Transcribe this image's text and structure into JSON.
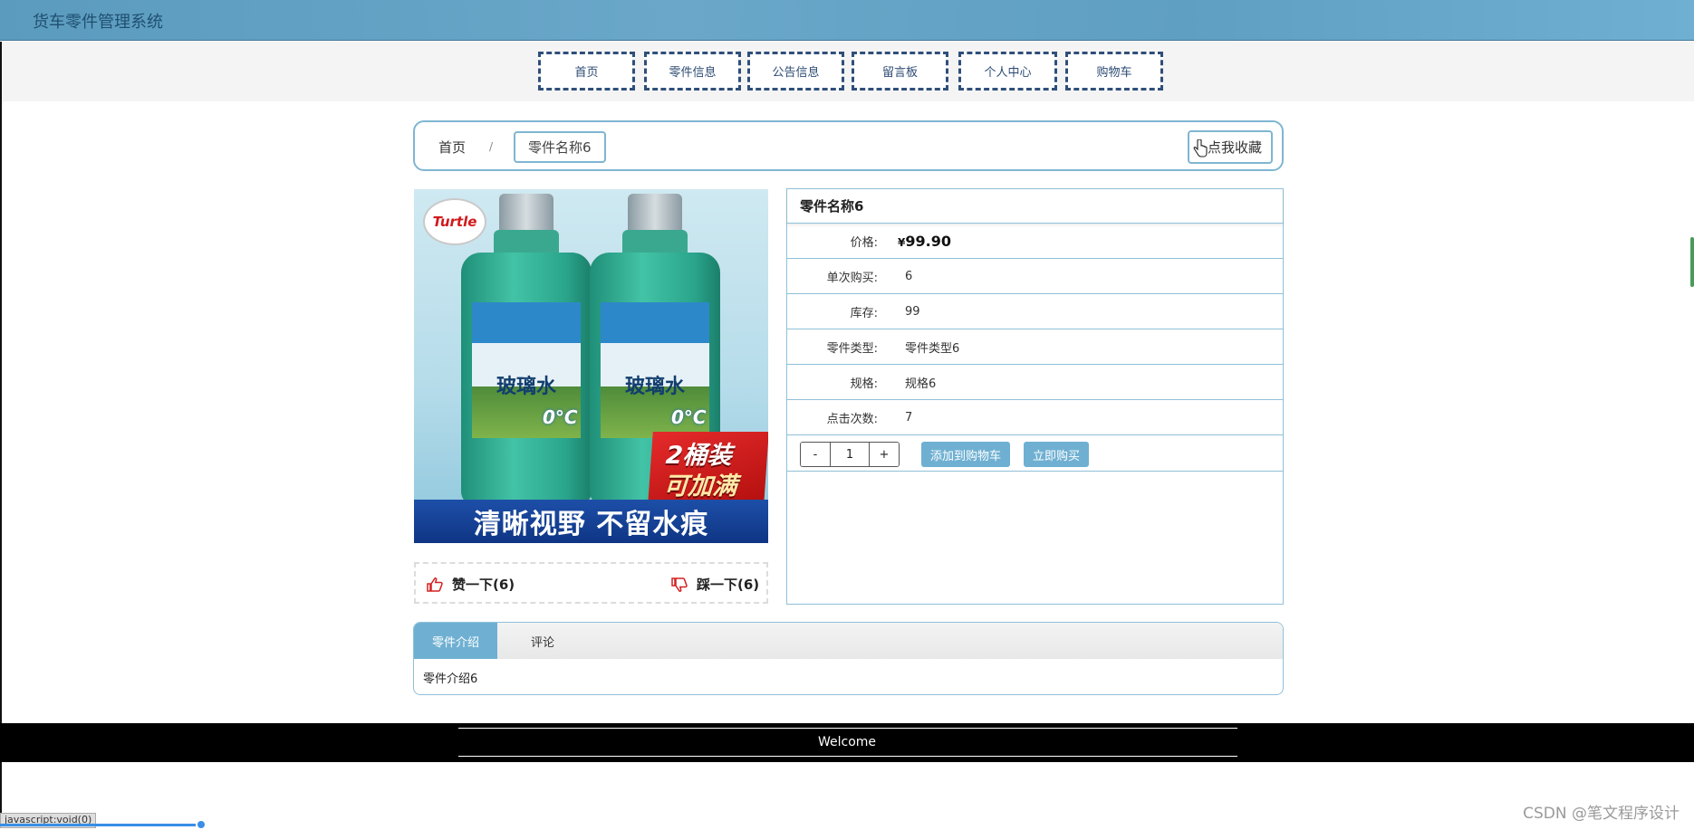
{
  "header": {
    "app_title": "货车零件管理系统"
  },
  "nav": {
    "items": [
      "首页",
      "零件信息",
      "公告信息",
      "留言板",
      "个人中心",
      "购物车"
    ]
  },
  "breadcrumb": {
    "home": "首页",
    "separator": "/",
    "current": "零件名称6",
    "favorite_label": "点我收藏"
  },
  "product": {
    "image": {
      "brand_text": "Turtle",
      "bottle_label": "玻璃水",
      "badge_line1": "2桶装",
      "badge_line2": "可加满",
      "banner": "清晰视野 不留水痕",
      "temp": "0°C"
    },
    "votes": {
      "like": "赞一下(6)",
      "dislike": "踩一下(6)"
    },
    "name": "零件名称6",
    "price_label": "价格:",
    "price_currency": "¥",
    "price": "99.90",
    "fields": [
      {
        "label": "单次购买:",
        "value": "6"
      },
      {
        "label": "库存:",
        "value": "99"
      },
      {
        "label": "零件类型:",
        "value": "零件类型6"
      },
      {
        "label": "规格:",
        "value": "规格6"
      },
      {
        "label": "点击次数:",
        "value": "7"
      }
    ],
    "quantity": {
      "minus": "-",
      "value": "1",
      "plus": "+"
    },
    "add_to_cart": "添加到购物车",
    "buy_now": "立即购买"
  },
  "tabs": {
    "items": [
      {
        "label": "零件介绍",
        "active": true
      },
      {
        "label": "评论",
        "active": false
      }
    ],
    "content": "零件介绍6"
  },
  "footer": {
    "welcome": "Welcome"
  },
  "status_bar": {
    "url": "javascript:void(0)"
  },
  "watermark": "CSDN @笔文程序设计",
  "colors": {
    "accent": "#6fb0d2",
    "nav_border": "#2f4f7a",
    "header_bg": "#5b9bbe",
    "footer_bg": "#000000"
  }
}
